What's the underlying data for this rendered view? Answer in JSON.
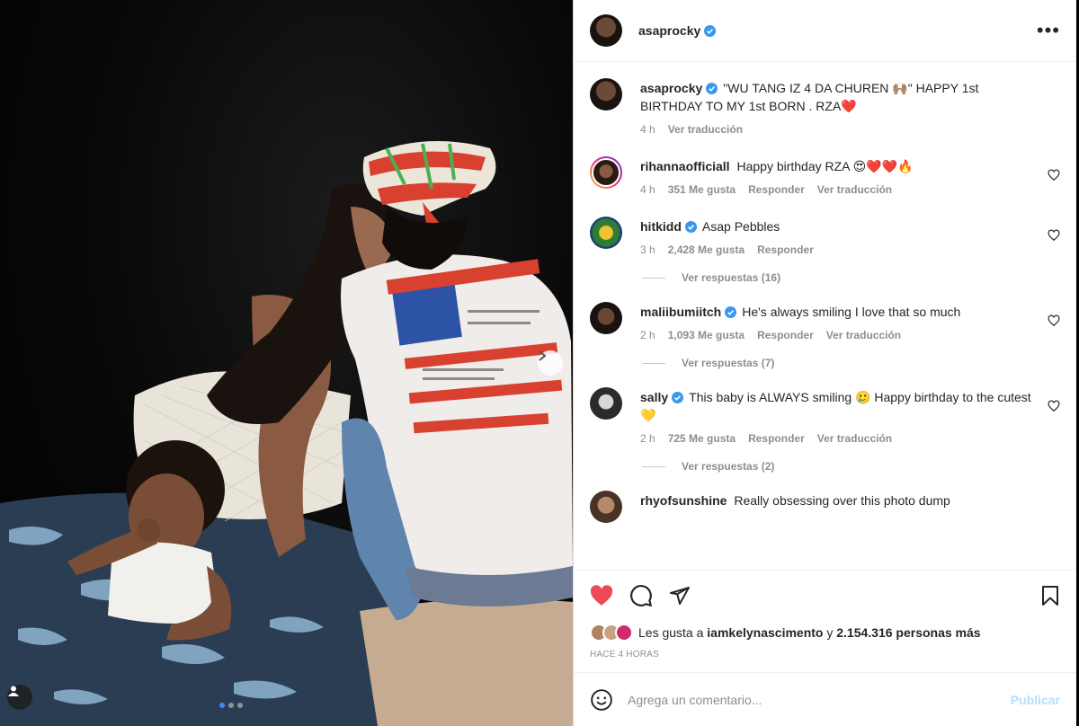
{
  "post": {
    "username": "asaprocky",
    "more_icon": "more-horizontal-icon"
  },
  "caption": {
    "username": "asaprocky",
    "text": "\"WU TANG IZ 4 DA CHUREN 🙌🏽\" HAPPY 1st BIRTHDAY TO MY 1st BORN . RZA❤️",
    "time": "4 h",
    "translate": "Ver traducción"
  },
  "comments": [
    {
      "username": "rihannaofficiall",
      "text": "Happy birthday RZA 😍❤️❤️🔥",
      "time": "4 h",
      "likes": "351 Me gusta",
      "reply": "Responder",
      "translate": "Ver traducción",
      "verified": false,
      "replies": ""
    },
    {
      "username": "hitkidd",
      "text": "Asap Pebbles",
      "time": "3 h",
      "likes": "2,428 Me gusta",
      "reply": "Responder",
      "translate": "",
      "verified": true,
      "replies": "Ver respuestas (16)"
    },
    {
      "username": "maliibumiitch",
      "text": "He's always smiling I love that so much",
      "time": "2 h",
      "likes": "1,093 Me gusta",
      "reply": "Responder",
      "translate": "Ver traducción",
      "verified": true,
      "replies": "Ver respuestas (7)"
    },
    {
      "username": "sally",
      "text": "This baby is ALWAYS smiling 🥲 Happy birthday to the cutest 💛",
      "time": "2 h",
      "likes": "725 Me gusta",
      "reply": "Responder",
      "translate": "Ver traducción",
      "verified": true,
      "replies": "Ver respuestas (2)"
    },
    {
      "username": "rhyofsunshine",
      "text": "Really obsessing over this photo dump",
      "time": "",
      "likes": "",
      "reply": "",
      "translate": "",
      "verified": false,
      "replies": ""
    }
  ],
  "likes": {
    "prefix": "Les gusta a",
    "user": "iamkelynascimento",
    "joiner": "y",
    "others": "2.154.316 personas más"
  },
  "time_ago": "HACE 4 HORAS",
  "add_comment": {
    "placeholder": "Agrega un comentario...",
    "publish": "Publicar"
  },
  "colors": {
    "liked": "#ed4956",
    "verified": "#3897f0",
    "publish_disabled": "#b2dffc"
  }
}
